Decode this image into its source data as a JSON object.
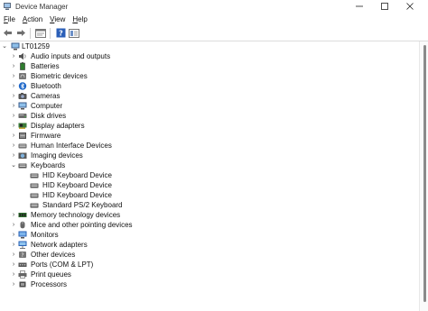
{
  "window": {
    "title": "Device Manager"
  },
  "menu": [
    {
      "label": "File",
      "mnemonic": "F",
      "rest": "ile"
    },
    {
      "label": "Action",
      "mnemonic": "A",
      "rest": "ction"
    },
    {
      "label": "View",
      "mnemonic": "V",
      "rest": "iew"
    },
    {
      "label": "Help",
      "mnemonic": "H",
      "rest": "elp"
    }
  ],
  "tree": {
    "root": "LT01259",
    "categories": [
      {
        "label": "Audio inputs and outputs",
        "icon": "speaker-icon"
      },
      {
        "label": "Batteries",
        "icon": "battery-icon"
      },
      {
        "label": "Biometric devices",
        "icon": "fingerprint-icon"
      },
      {
        "label": "Bluetooth",
        "icon": "bluetooth-icon"
      },
      {
        "label": "Cameras",
        "icon": "camera-icon"
      },
      {
        "label": "Computer",
        "icon": "computer-icon"
      },
      {
        "label": "Disk drives",
        "icon": "disk-drive-icon"
      },
      {
        "label": "Display adapters",
        "icon": "display-adapter-icon"
      },
      {
        "label": "Firmware",
        "icon": "firmware-icon"
      },
      {
        "label": "Human Interface Devices",
        "icon": "hid-icon"
      },
      {
        "label": "Imaging devices",
        "icon": "imaging-icon"
      },
      {
        "label": "Keyboards",
        "icon": "keyboard-icon",
        "expanded": true,
        "children": [
          "HID Keyboard Device",
          "HID Keyboard Device",
          "HID Keyboard Device",
          "Standard PS/2 Keyboard"
        ]
      },
      {
        "label": "Memory technology devices",
        "icon": "memory-icon"
      },
      {
        "label": "Mice and other pointing devices",
        "icon": "mouse-icon"
      },
      {
        "label": "Monitors",
        "icon": "monitor-icon"
      },
      {
        "label": "Network adapters",
        "icon": "network-icon"
      },
      {
        "label": "Other devices",
        "icon": "other-devices-icon"
      },
      {
        "label": "Ports (COM & LPT)",
        "icon": "port-icon"
      },
      {
        "label": "Print queues",
        "icon": "printer-icon"
      },
      {
        "label": "Processors",
        "icon": "processor-icon"
      }
    ]
  }
}
